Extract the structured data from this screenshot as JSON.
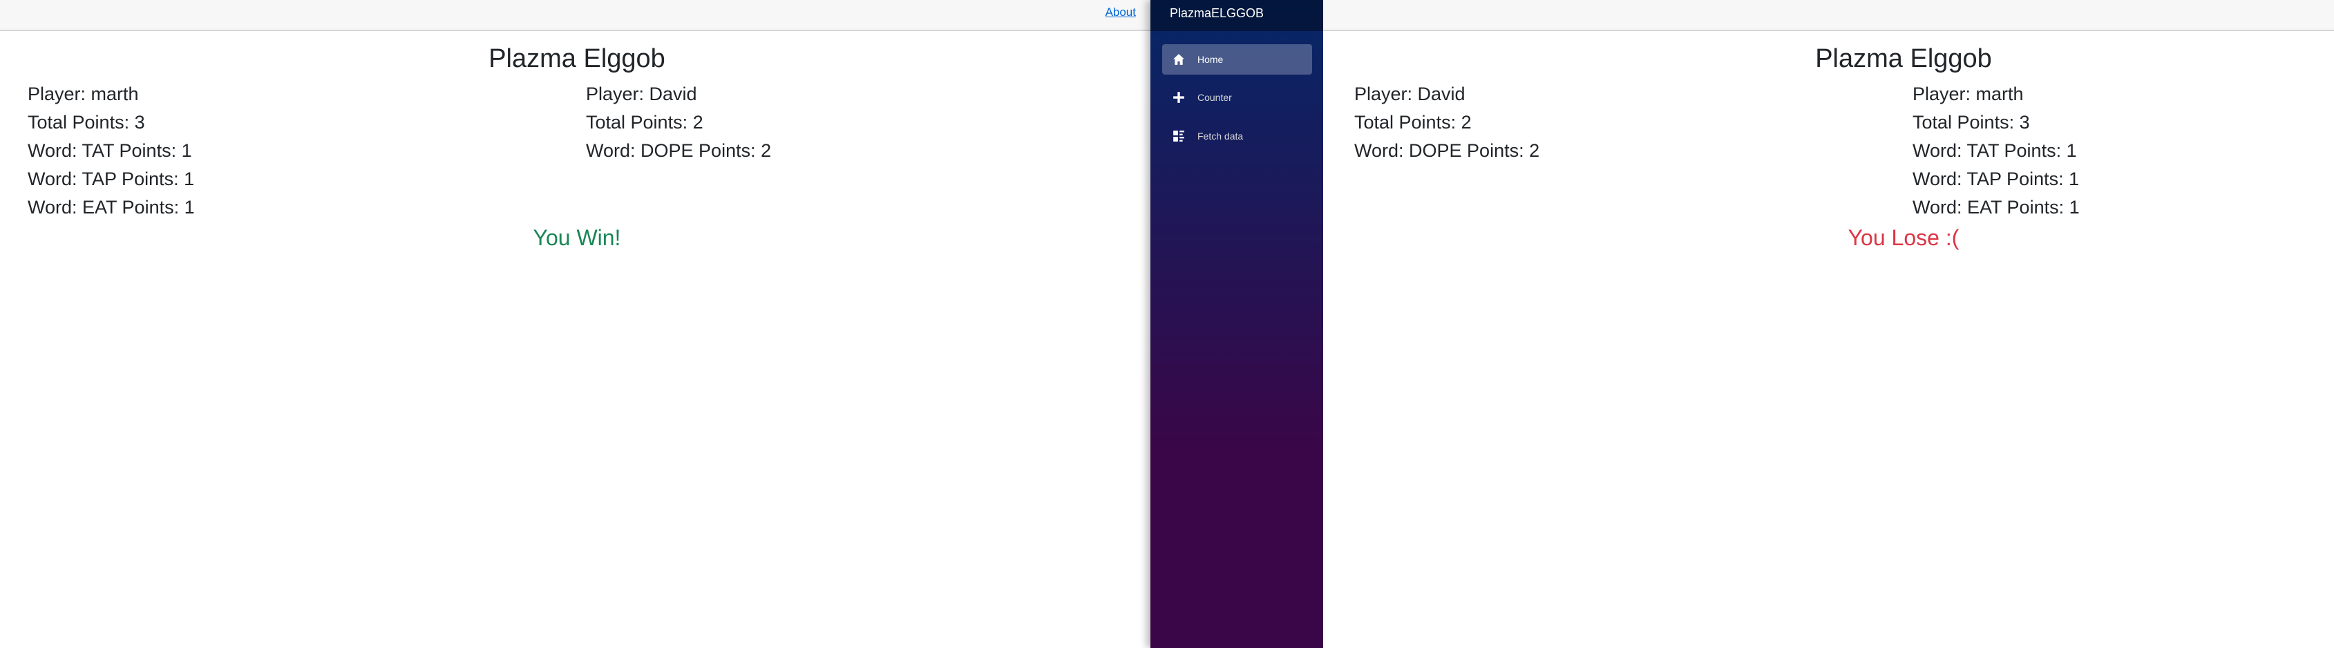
{
  "top_row": {
    "about_label": "About"
  },
  "sidebar": {
    "brand": "PlazmaELGGOB",
    "items": [
      {
        "label": "Home",
        "icon": "home-icon",
        "active": true
      },
      {
        "label": "Counter",
        "icon": "plus-icon",
        "active": false
      },
      {
        "label": "Fetch data",
        "icon": "list-rich-icon",
        "active": false
      }
    ]
  },
  "left_view": {
    "title": "Plazma Elggob",
    "player1": {
      "name": "Player: marth",
      "total": "Total Points: 3",
      "words": [
        "Word: TAT Points: 1",
        "Word: TAP Points: 1",
        "Word: EAT Points: 1"
      ]
    },
    "player2": {
      "name": "Player: David",
      "total": "Total Points: 2",
      "words": [
        "Word: DOPE Points: 2"
      ]
    },
    "result": "You Win!"
  },
  "right_view": {
    "title": "Plazma Elggob",
    "player1": {
      "name": "Player: David",
      "total": "Total Points: 2",
      "words": [
        "Word: DOPE Points: 2"
      ]
    },
    "player2": {
      "name": "Player: marth",
      "total": "Total Points: 3",
      "words": [
        "Word: TAT Points: 1",
        "Word: TAP Points: 1",
        "Word: EAT Points: 1"
      ]
    },
    "result": "You Lose :("
  },
  "colors": {
    "win": "#198754",
    "lose": "#dc3545",
    "sidebar_top": "#052767",
    "sidebar_bottom": "#3a0647"
  }
}
